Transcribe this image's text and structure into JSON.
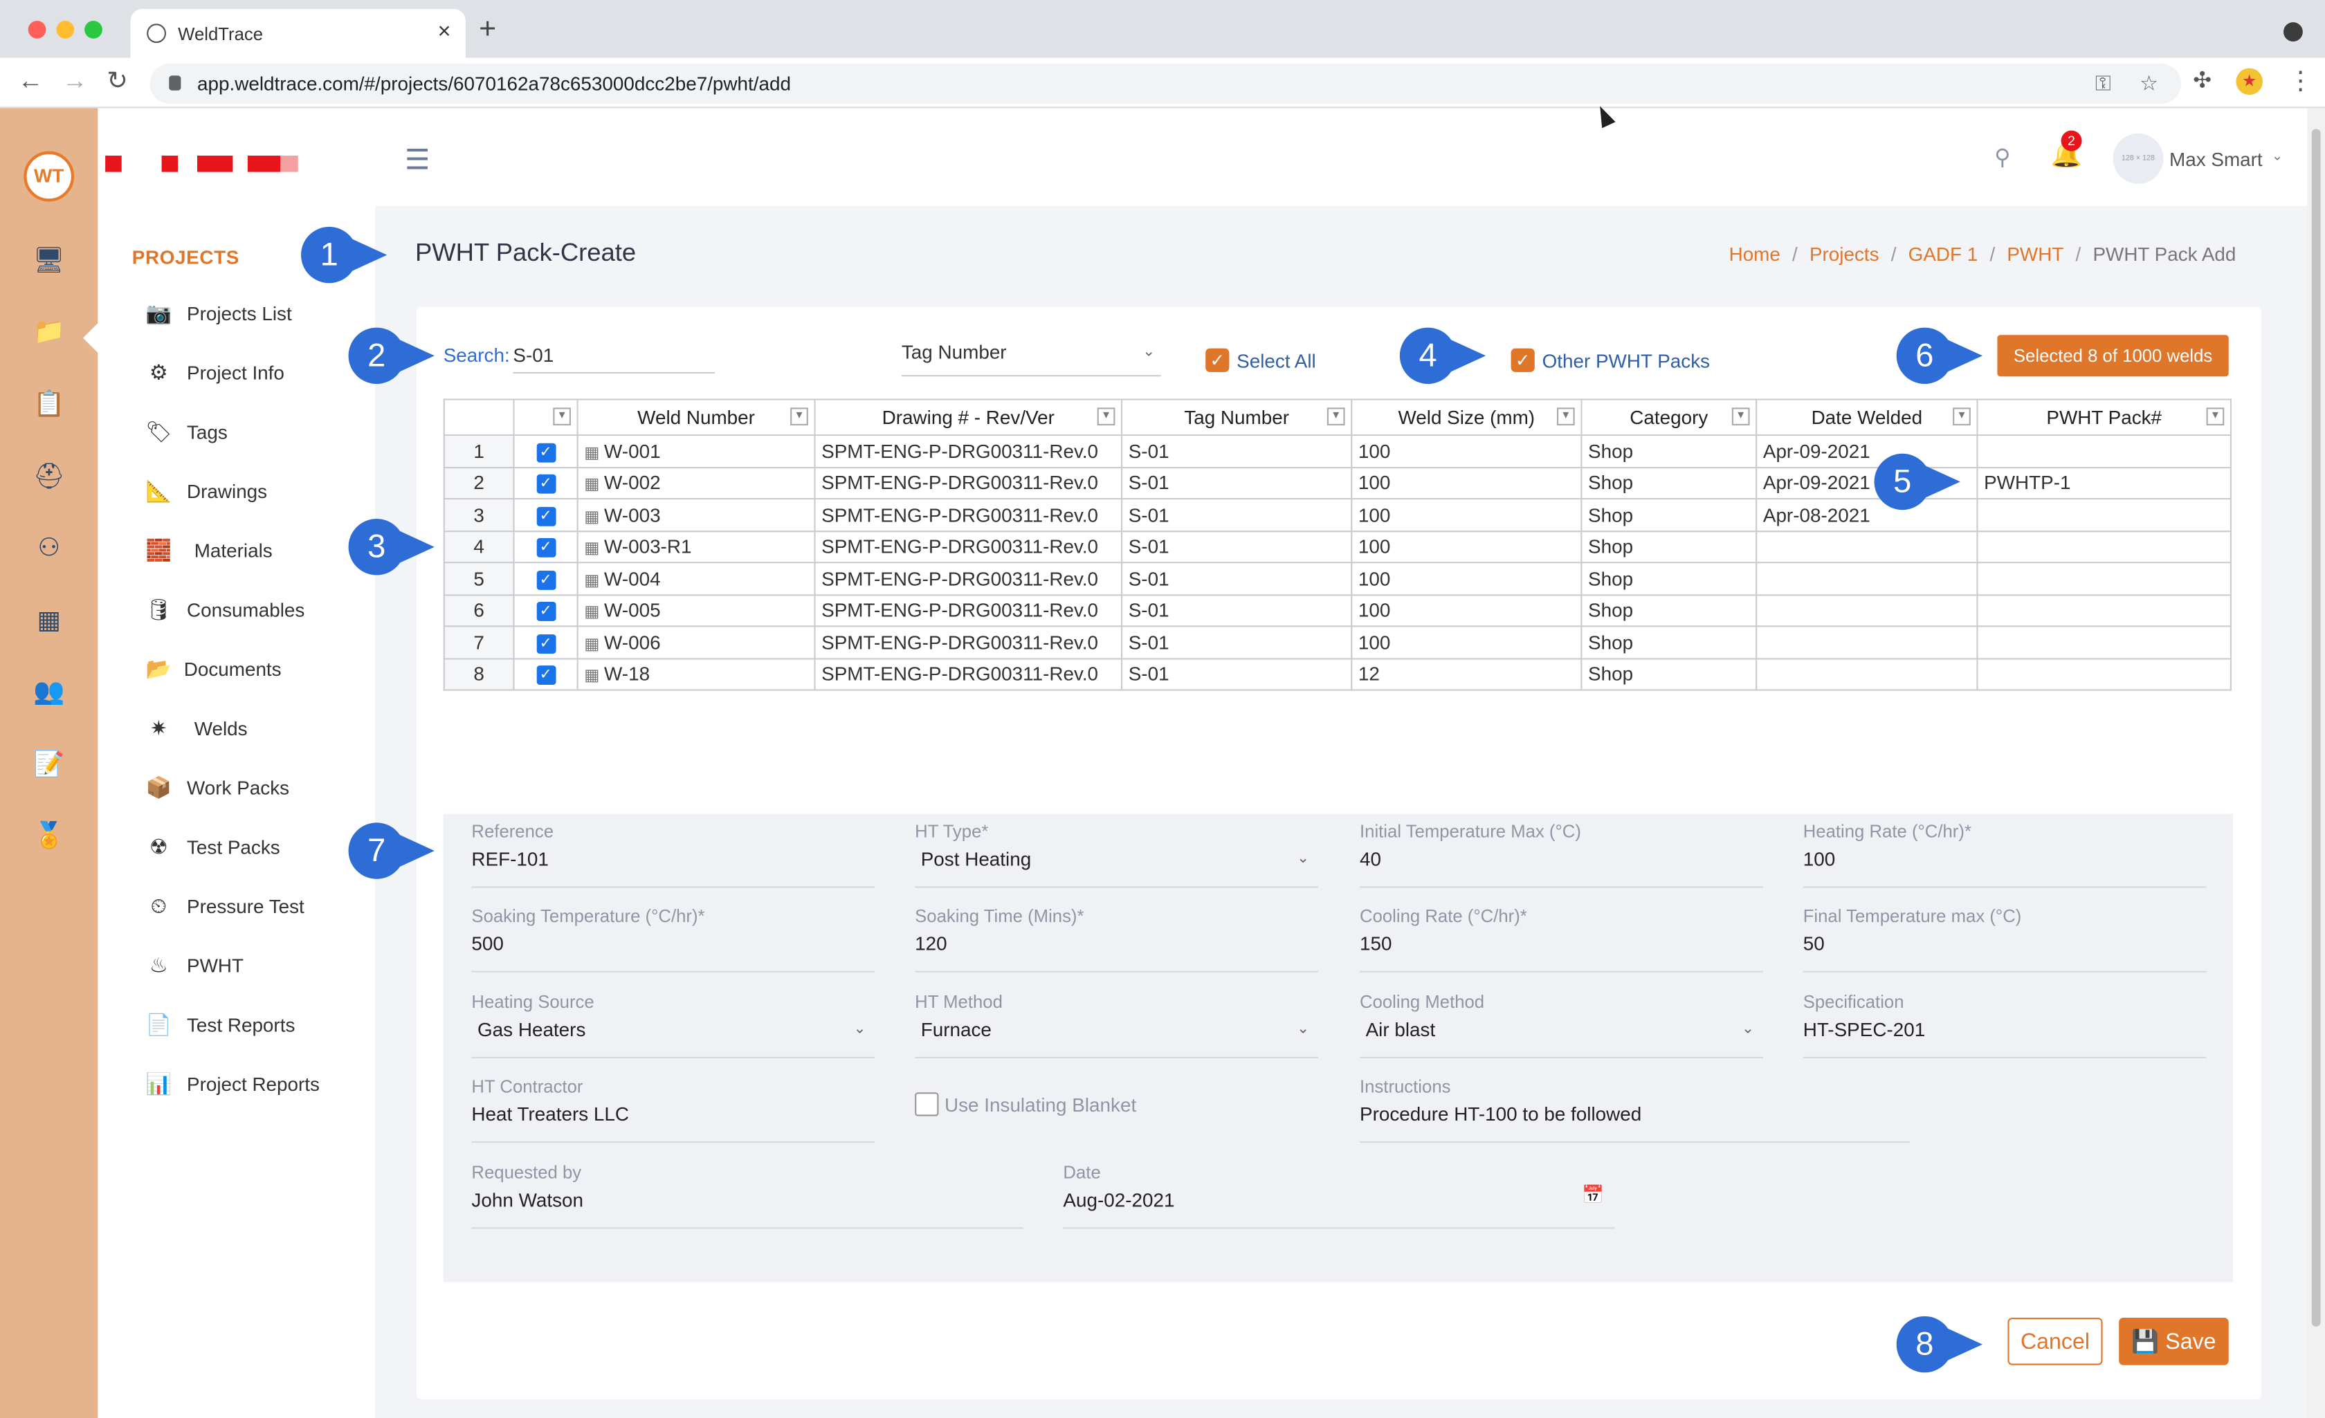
{
  "browser": {
    "tab_title": "WeldTrace",
    "url": "app.weldtrace.com/#/projects/6070162a78c653000dcc2be7/pwht/add",
    "tab_close": "×",
    "new_tab": "+"
  },
  "rail": {
    "logo": "WT",
    "icons": [
      "monitor-icon",
      "project-folder-icon",
      "settings-clipboard-icon",
      "welder-icon",
      "org-chart-icon",
      "monitor-chart-icon",
      "team-icon",
      "report-clock-icon",
      "certificate-icon"
    ]
  },
  "sidebar": {
    "section_title": "PROJECTS",
    "items": [
      {
        "label": "Projects List",
        "icon": "camera-icon"
      },
      {
        "label": "Project Info",
        "icon": "gears-icon"
      },
      {
        "label": "Tags",
        "icon": "tag-icon"
      },
      {
        "label": "Drawings",
        "icon": "drawing-icon"
      },
      {
        "label": "Materials",
        "icon": "materials-icon"
      },
      {
        "label": "Consumables",
        "icon": "barrel-icon"
      },
      {
        "label": "Documents",
        "icon": "folder-icon"
      },
      {
        "label": "Welds",
        "icon": "weld-spark-icon"
      },
      {
        "label": "Work Packs",
        "icon": "workpack-icon"
      },
      {
        "label": "Test Packs",
        "icon": "radiation-icon"
      },
      {
        "label": "Pressure Test",
        "icon": "gauge-icon"
      },
      {
        "label": "PWHT",
        "icon": "heater-icon"
      },
      {
        "label": "Test Reports",
        "icon": "report-icon"
      },
      {
        "label": "Project Reports",
        "icon": "project-report-icon"
      }
    ]
  },
  "header": {
    "notifications": "2",
    "avatar_text": "128 × 128",
    "user_name": "Max Smart"
  },
  "page": {
    "title": "PWHT Pack-Create",
    "breadcrumb": [
      "Home",
      "Projects",
      "GADF 1",
      "PWHT"
    ],
    "breadcrumb_current": "PWHT Pack Add"
  },
  "filters": {
    "search_label": "Search:",
    "search_value": "S-01",
    "search_by": "Tag Number",
    "select_all_label": "Select All",
    "other_packs_label": "Other PWHT Packs",
    "selected_count": "Selected 8 of 1000 welds"
  },
  "annotations": [
    "1",
    "2",
    "3",
    "4",
    "5",
    "6",
    "7",
    "8"
  ],
  "table": {
    "columns": [
      "",
      "",
      "Weld Number",
      "Drawing # - Rev/Ver",
      "Tag Number",
      "Weld Size (mm)",
      "Category",
      "Date Welded",
      "PWHT Pack#"
    ],
    "rows": [
      {
        "n": "1",
        "weld": "W-001",
        "drawing": "SPMT-ENG-P-DRG00311-Rev.0",
        "tag": "S-01",
        "size": "100",
        "cat": "Shop",
        "date": "Apr-09-2021",
        "pack": ""
      },
      {
        "n": "2",
        "weld": "W-002",
        "drawing": "SPMT-ENG-P-DRG00311-Rev.0",
        "tag": "S-01",
        "size": "100",
        "cat": "Shop",
        "date": "Apr-09-2021",
        "pack": "PWHTP-1"
      },
      {
        "n": "3",
        "weld": "W-003",
        "drawing": "SPMT-ENG-P-DRG00311-Rev.0",
        "tag": "S-01",
        "size": "100",
        "cat": "Shop",
        "date": "Apr-08-2021",
        "pack": ""
      },
      {
        "n": "4",
        "weld": "W-003-R1",
        "drawing": "SPMT-ENG-P-DRG00311-Rev.0",
        "tag": "S-01",
        "size": "100",
        "cat": "Shop",
        "date": "",
        "pack": ""
      },
      {
        "n": "5",
        "weld": "W-004",
        "drawing": "SPMT-ENG-P-DRG00311-Rev.0",
        "tag": "S-01",
        "size": "100",
        "cat": "Shop",
        "date": "",
        "pack": ""
      },
      {
        "n": "6",
        "weld": "W-005",
        "drawing": "SPMT-ENG-P-DRG00311-Rev.0",
        "tag": "S-01",
        "size": "100",
        "cat": "Shop",
        "date": "",
        "pack": ""
      },
      {
        "n": "7",
        "weld": "W-006",
        "drawing": "SPMT-ENG-P-DRG00311-Rev.0",
        "tag": "S-01",
        "size": "100",
        "cat": "Shop",
        "date": "",
        "pack": ""
      },
      {
        "n": "8",
        "weld": "W-18",
        "drawing": "SPMT-ENG-P-DRG00311-Rev.0",
        "tag": "S-01",
        "size": "12",
        "cat": "Shop",
        "date": "",
        "pack": ""
      }
    ]
  },
  "form": {
    "reference": {
      "label": "Reference",
      "value": "REF-101"
    },
    "ht_type": {
      "label": "HT Type*",
      "value": "Post Heating"
    },
    "initial_temp": {
      "label": "Initial Temperature Max (°C)",
      "value": "40"
    },
    "heating_rate": {
      "label": "Heating Rate (°C/hr)*",
      "value": "100"
    },
    "soaking_temp": {
      "label": "Soaking Temperature (°C/hr)*",
      "value": "500"
    },
    "soaking_time": {
      "label": "Soaking Time (Mins)*",
      "value": "120"
    },
    "cooling_rate": {
      "label": "Cooling Rate (°C/hr)*",
      "value": "150"
    },
    "final_temp": {
      "label": "Final Temperature max (°C)",
      "value": "50"
    },
    "heating_source": {
      "label": "Heating Source",
      "value": "Gas Heaters"
    },
    "ht_method": {
      "label": "HT Method",
      "value": "Furnace"
    },
    "cooling_method": {
      "label": "Cooling Method",
      "value": "Air blast"
    },
    "specification": {
      "label": "Specification",
      "value": "HT-SPEC-201"
    },
    "ht_contractor": {
      "label": "HT Contractor",
      "value": "Heat Treaters LLC"
    },
    "insulating_blanket": {
      "label": "Use Insulating Blanket"
    },
    "instructions": {
      "label": "Instructions",
      "value": "Procedure HT-100 to be followed"
    },
    "requested_by": {
      "label": "Requested by",
      "value": "John Watson"
    },
    "date": {
      "label": "Date",
      "value": "Aug-02-2021"
    }
  },
  "actions": {
    "cancel": "Cancel",
    "save": "Save"
  }
}
